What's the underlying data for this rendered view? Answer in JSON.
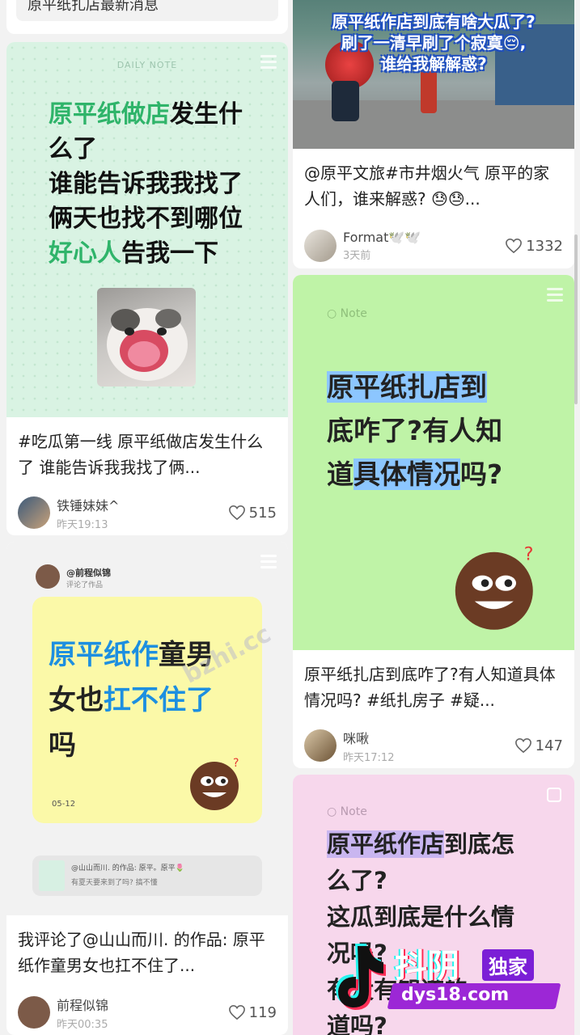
{
  "cards": {
    "top_left_partial": {
      "text": "原平纸扎店最新消息"
    },
    "c1": {
      "daily_label": "DAILY NOTE",
      "cover_lines": [
        {
          "a": "原平纸做店",
          "b": "发生什"
        },
        {
          "a": "",
          "b": "么了"
        },
        {
          "a": "",
          "b": "谁能告诉我我找了"
        },
        {
          "a": "",
          "b": "俩天也找不到哪位"
        },
        {
          "a": "好心人",
          "b": "告我一下"
        }
      ],
      "title": "#吃瓜第一线 原平纸做店发生什么了 谁能告诉我我找了俩...",
      "author": "铁锤妹妹^",
      "time": "昨天19:13",
      "likes": "515"
    },
    "c2": {
      "overlay_line1": "原平纸作店到底有啥大瓜了?",
      "overlay_line2": "刷了一清早刷了个寂寞😔,",
      "overlay_line3": "谁给我解解惑?",
      "title": "@原平文旅#市井烟火气 原平的家人们，谁来解惑? 😓😓...",
      "author": "Format🕊️🕊️",
      "time": "3天前",
      "likes": "1332"
    },
    "c3": {
      "note_label": "Note",
      "lines": [
        {
          "a": "原平纸扎店到",
          "b": ""
        },
        {
          "a": "底咋了?有人知",
          "b": ""
        },
        {
          "a": "道",
          "b": "具体情况",
          "c": "吗?"
        }
      ],
      "title": "原平纸扎店到底咋了?有人知道具体情况吗? #纸扎房子 #疑...",
      "author": "咪啾",
      "time": "昨天17:12",
      "likes": "147"
    },
    "c4": {
      "header_user": "@前程似锦",
      "header_sub": "评论了作品",
      "lines": [
        {
          "a": "原平纸作",
          "b": "童男"
        },
        {
          "a": "女也",
          "b": "扛不住了"
        },
        {
          "a": "吗",
          "b": ""
        }
      ],
      "date": "05-12",
      "quote_line1": "@山山而川. 的作品: 原平。原平🌷",
      "quote_line2": "有夏天要来到了吗? 搞不懂",
      "title": "我评论了@山山而川. 的作品: 原平纸作童男女也扛不住了...",
      "author": "前程似锦",
      "time": "昨天00:35",
      "likes": "119"
    },
    "c5": {
      "note_label": "Note",
      "lines": [
        {
          "a": "原平纸作店",
          "b": "到底怎"
        },
        {
          "a": "么了?",
          "b": ""
        },
        {
          "a": "这瓜到底是什么情",
          "b": ""
        },
        {
          "a": "况吗?",
          "b": ""
        },
        {
          "a": "有没有知道的",
          "b": ""
        },
        {
          "a": "道吗?",
          "b": ""
        }
      ]
    }
  },
  "watermarks": {
    "center": "bzhi.cc",
    "brand": "抖阴",
    "exclusive": "独家",
    "site": "dys18.com"
  },
  "colors": {
    "green_cover": "#d9f3e3",
    "lime_cover": "#bff3a7",
    "yellow_card": "#fbf9a8",
    "pink_cover": "#f7d7ec"
  }
}
